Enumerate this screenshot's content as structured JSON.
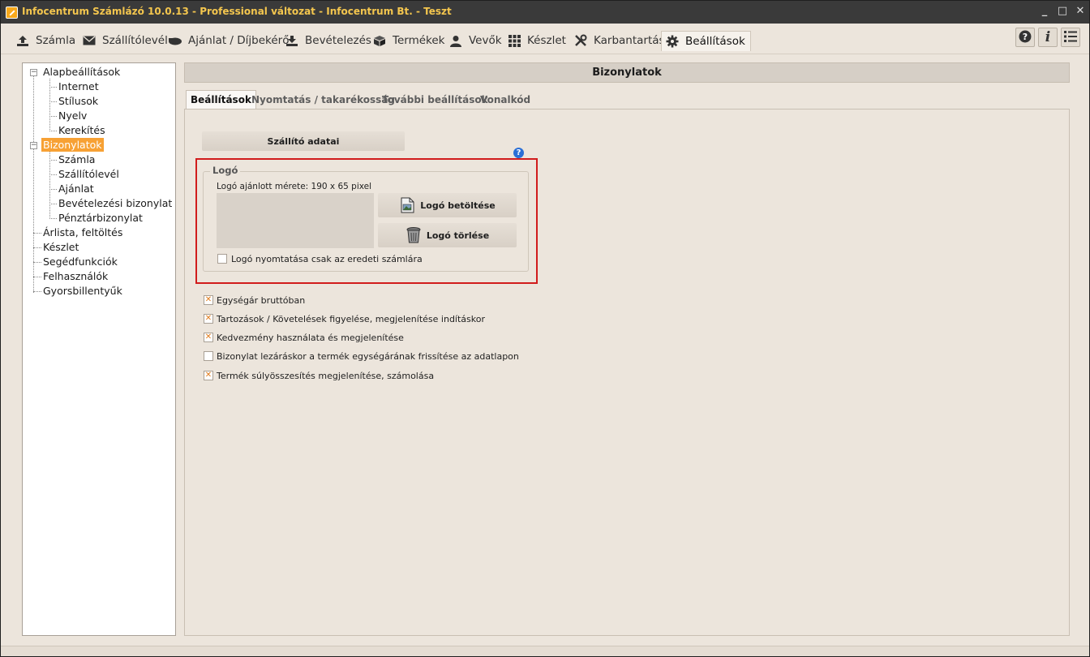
{
  "window": {
    "title": "Infocentrum Számlázó 10.0.13 - Professional változat - Infocentrum Bt. - Teszt",
    "controls": [
      "_",
      "□",
      "✕"
    ]
  },
  "menu": {
    "items": [
      {
        "label": "Számla",
        "icon": "upload-icon"
      },
      {
        "label": "Szállítólevél",
        "icon": "envelope-icon"
      },
      {
        "label": "Ajánlat / Díjbekérő",
        "icon": "hand-icon"
      },
      {
        "label": "Bevételezés",
        "icon": "download-icon"
      },
      {
        "label": "Termékek",
        "icon": "box-icon"
      },
      {
        "label": "Vevők",
        "icon": "person-icon"
      },
      {
        "label": "Készlet",
        "icon": "grid-icon"
      },
      {
        "label": "Karbantartás",
        "icon": "tools-icon"
      },
      {
        "label": "Beállítások",
        "icon": "gear-icon"
      }
    ],
    "right_buttons": [
      "help-icon",
      "info-icon",
      "list-icon"
    ]
  },
  "tree": {
    "items": [
      {
        "label": "Alapbeállítások",
        "level": 0,
        "expanded": true
      },
      {
        "label": "Internet",
        "level": 1
      },
      {
        "label": "Stílusok",
        "level": 1
      },
      {
        "label": "Nyelv",
        "level": 1
      },
      {
        "label": "Kerekítés",
        "level": 1
      },
      {
        "label": "Bizonylatok",
        "level": 0,
        "expanded": true,
        "selected": true
      },
      {
        "label": "Számla",
        "level": 1
      },
      {
        "label": "Szállítólevél",
        "level": 1
      },
      {
        "label": "Ajánlat",
        "level": 1
      },
      {
        "label": "Bevételezési bizonylat",
        "level": 1
      },
      {
        "label": "Pénztárbizonylat",
        "level": 1
      },
      {
        "label": "Árlista, feltöltés",
        "level": 0
      },
      {
        "label": "Készlet",
        "level": 0
      },
      {
        "label": "Segédfunkciók",
        "level": 0
      },
      {
        "label": "Felhasználók",
        "level": 0
      },
      {
        "label": "Gyorsbillentyűk",
        "level": 0
      }
    ]
  },
  "main": {
    "header": "Bizonylatok",
    "tabs": [
      {
        "label": "Beállítások",
        "active": true
      },
      {
        "label": "Nyomtatás / takarékosság"
      },
      {
        "label": "További beállítások"
      },
      {
        "label": "Vonalkód"
      }
    ],
    "supplier_button": "Szállító adatai",
    "logo_group": {
      "title": "Logó",
      "size_hint": "Logó ajánlott mérete: 190 x 65 pixel",
      "load_button": "Logó betöltése",
      "delete_button": "Logó törlése",
      "print_checkbox": {
        "label": "Logó nyomtatása csak az eredeti számlára",
        "checked": false
      }
    },
    "options": [
      {
        "label": "Egységár bruttóban",
        "checked": true
      },
      {
        "label": "Tartozások / Követelések figyelése, megjelenítése indításkor",
        "checked": true
      },
      {
        "label": "Kedvezmény használata és megjelenítése",
        "checked": true
      },
      {
        "label": "Bizonylat lezáráskor a termék egységárának frissítése az adatlapon",
        "checked": false
      },
      {
        "label": "Termék súlyösszesítés megjelenítése, számolása",
        "checked": true
      }
    ]
  },
  "colors": {
    "title_text": "#f4c64e",
    "selection": "#f7a134",
    "highlight_border": "#d11c1c",
    "help_blue": "#2a6fd6"
  }
}
